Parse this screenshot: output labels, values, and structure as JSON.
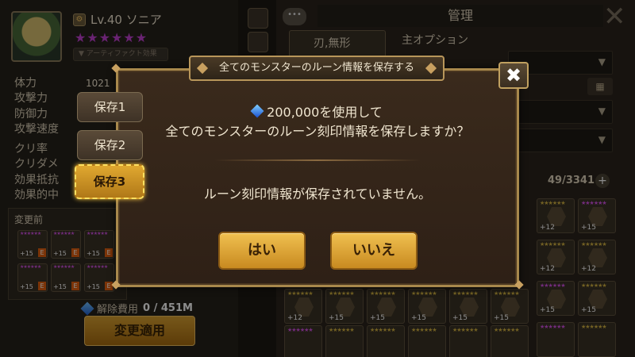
{
  "character": {
    "level_text": "Lv.40 ソニア",
    "stars": "★★★★★★",
    "artifact_label": "▼ アーティファクト効果"
  },
  "stats": [
    {
      "label": "体力",
      "value": "1021"
    },
    {
      "label": "攻撃力",
      "value": ""
    },
    {
      "label": "防御力",
      "value": ""
    },
    {
      "label": "攻撃速度",
      "value": ""
    },
    {
      "label": "クリ率",
      "value": ""
    },
    {
      "label": "クリダメ",
      "value": ""
    },
    {
      "label": "効果抵抗",
      "value": ""
    },
    {
      "label": "効果的中",
      "value": ""
    }
  ],
  "before_panel": {
    "label": "変更前"
  },
  "cost": {
    "label": "解除費用",
    "value": "0 / 451M"
  },
  "apply_button": "変更適用",
  "right_panel": {
    "title": "管理",
    "edge_filter": "刃,無形",
    "main_option_label": "主オプション",
    "rune_count": "49/3341"
  },
  "modal": {
    "title": "全てのモンスターのルーン情報を保存する",
    "cost_text": "200,000を使用して",
    "question": "全てのモンスターのルーン刻印情報を保存しますか？",
    "status": "ルーン刻印情報が保存されていません。",
    "yes": "はい",
    "no": "いいえ",
    "close": "✖"
  },
  "save_slots": [
    {
      "label": "保存1",
      "active": false
    },
    {
      "label": "保存2",
      "active": false
    },
    {
      "label": "保存3",
      "active": true
    }
  ],
  "icons": {
    "gem": "crystal-gem-icon",
    "close": "close-icon",
    "chat": "chat-bubble-icon",
    "grid": "grid-view-icon"
  },
  "colors": {
    "accent_gold": "#e0a830",
    "modal_border": "#a8884c",
    "star_purple": "#c040d0"
  }
}
